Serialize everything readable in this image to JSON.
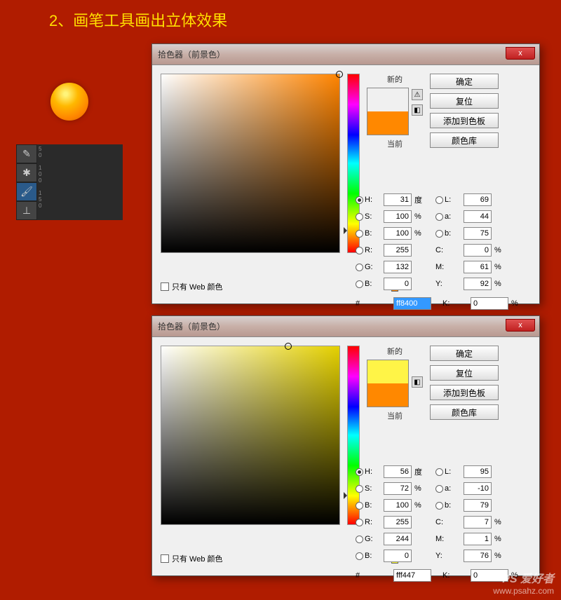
{
  "heading": "2、画笔工具画出立体效果",
  "dialog": {
    "title": "拾色器（前景色）",
    "close": "x",
    "btn_ok": "确定",
    "btn_reset": "复位",
    "btn_add": "添加到色板",
    "btn_lib": "颜色库",
    "label_new": "新的",
    "label_current": "当前",
    "web_only": "只有 Web 颜色",
    "labels": {
      "H": "H:",
      "S": "S:",
      "B": "B:",
      "R": "R:",
      "G": "G:",
      "Bch": "B:",
      "L": "L:",
      "a": "a:",
      "bch": "b:",
      "C": "C:",
      "M": "M:",
      "Y": "Y:",
      "K": "K:",
      "hash": "#"
    },
    "units": {
      "deg": "度",
      "pct": "%"
    }
  },
  "picker1": {
    "swatch_new": "#ff8400",
    "swatch_current": "#ff8800",
    "H": "31",
    "S": "100",
    "B": "100",
    "R": "255",
    "G": "132",
    "Bch": "0",
    "L": "69",
    "a": "44",
    "b": "75",
    "C": "0",
    "M": "61",
    "Y": "92",
    "K": "0",
    "hex": "ff8400"
  },
  "picker2": {
    "swatch_new": "#fff447",
    "swatch_current": "#ff8800",
    "H": "56",
    "S": "72",
    "B": "100",
    "R": "255",
    "G": "244",
    "Bch": "0",
    "L": "95",
    "a": "-10",
    "b": "79",
    "C": "7",
    "M": "1",
    "Y": "76",
    "K": "0",
    "hex": "fff447"
  },
  "watermark": {
    "l1": "PS 爱好者",
    "l2": "www.psahz.com"
  }
}
